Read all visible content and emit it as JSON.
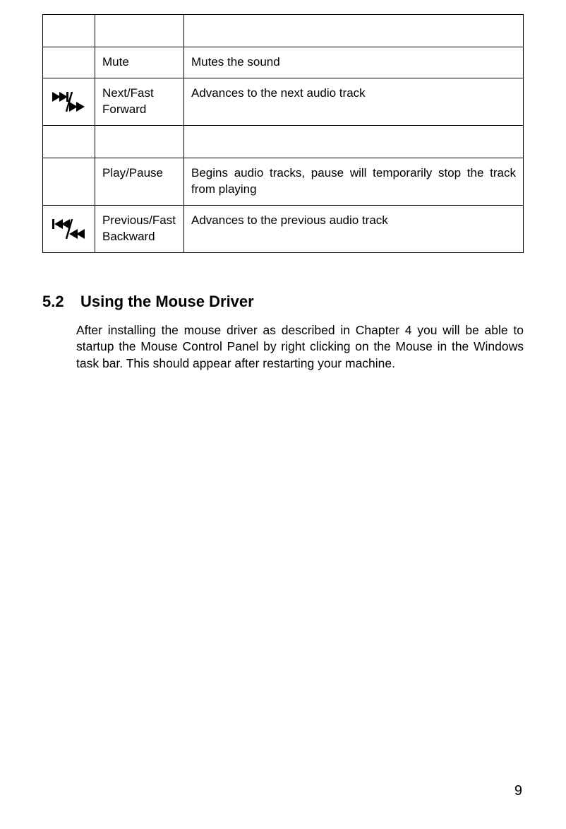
{
  "table": {
    "rows": [
      {
        "icon": "",
        "name": "",
        "desc": ""
      },
      {
        "icon": "",
        "name": "Mute",
        "desc": "Mutes the sound"
      },
      {
        "icon": "next-icon",
        "name": "Next/Fast Forward",
        "desc": "Advances to the next audio track"
      },
      {
        "icon": "",
        "name": "",
        "desc": ""
      },
      {
        "icon": "",
        "name": "Play/Pause",
        "desc": "Begins audio tracks, pause will temporarily stop the track from playing"
      },
      {
        "icon": "prev-icon",
        "name": "Previous/Fast Backward",
        "desc": "Advances to the previous audio track"
      }
    ]
  },
  "section": {
    "number": "5.2",
    "title": "Using the Mouse Driver",
    "body": "After installing the mouse driver as described in Chapter 4 you will be able to startup the Mouse Control Panel by right clicking on the Mouse in the Windows task bar.   This should appear after restarting your machine."
  },
  "page_number": "9"
}
